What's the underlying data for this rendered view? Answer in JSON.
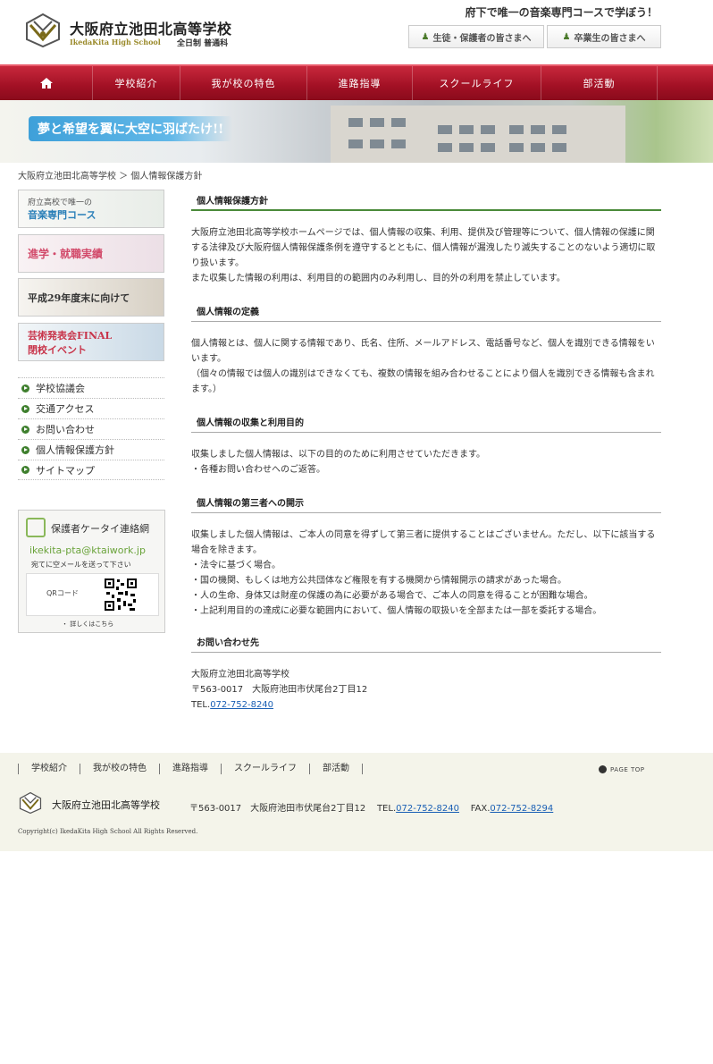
{
  "header": {
    "school_name": "大阪府立池田北高等学校",
    "school_name_en": "IkedaKita High School",
    "course": "全日制 普通科",
    "catch": "府下で唯一の音楽専門コースで学ぼう！",
    "btn_students": "生徒・保護者の皆さまへ",
    "btn_alumni": "卒業生の皆さまへ",
    "logo_icon": "school-emblem-icon",
    "person_icon": "person-icon"
  },
  "nav": {
    "home_icon": "home-icon",
    "items": [
      "学校紹介",
      "我が校の特色",
      "進路指導",
      "スクールライフ",
      "部活動"
    ]
  },
  "banner": {
    "catch": "夢と希望を翼に大空に羽ばたけ!!"
  },
  "breadcrumb": {
    "home": "大阪府立池田北高等学校",
    "sep": "＞",
    "current": "個人情報保護方針"
  },
  "sidebar": {
    "banner1_small": "府立高校で唯一の",
    "banner1_large": "音楽専門コース",
    "banner2": "進学・就職実績",
    "banner3": "平成29年度末に向けて",
    "banner4_line1": "芸術発表会FINAL",
    "banner4_line2": "閉校イベント",
    "links": [
      "学校協議会",
      "交通アクセス",
      "お問い合わせ",
      "個人情報保護方針",
      "サイトマップ"
    ],
    "pta": {
      "title": "保護者ケータイ連絡網",
      "email": "ikekita-pta@ktaiwork.jp",
      "note": "宛てに空メールを送って下さい",
      "qr_label": "QRコード",
      "more": "・ 詳しくはこちら"
    }
  },
  "main": {
    "title": "個人情報保護方針",
    "intro": [
      "大阪府立池田北高等学校ホームページでは、個人情報の収集、利用、提供及び管理等について、個人情報の保護に関する法律及び大阪府個人情報保護条例を遵守するとともに、個人情報が漏洩したり滅失することのないよう適切に取り扱います。",
      "また収集した情報の利用は、利用目的の範囲内のみ利用し、目的外の利用を禁止しています。"
    ],
    "sections": [
      {
        "heading": "個人情報の定義",
        "paragraphs": [
          "個人情報とは、個人に関する情報であり、氏名、住所、メールアドレス、電話番号など、個人を識別できる情報をいいます。",
          "（個々の情報では個人の識別はできなくても、複数の情報を組み合わせることにより個人を識別できる情報も含まれます。）"
        ]
      },
      {
        "heading": "個人情報の収集と利用目的",
        "paragraphs": [
          "収集しました個人情報は、以下の目的のために利用させていただきます。",
          "・各種お問い合わせへのご返答。"
        ]
      },
      {
        "heading": "個人情報の第三者への開示",
        "paragraphs": [
          "収集しました個人情報は、ご本人の同意を得ずして第三者に提供することはございません。ただし、以下に該当する場合を除きます。",
          "・法令に基づく場合。",
          "・国の機関、もしくは地方公共団体など権限を有する機関から情報開示の請求があった場合。",
          "・人の生命、身体又は財産の保護の為に必要がある場合で、ご本人の同意を得ることが困難な場合。",
          "・上記利用目的の達成に必要な範囲内において、個人情報の取扱いを全部または一部を委託する場合。"
        ]
      }
    ],
    "contact_heading": "お問い合わせ先",
    "contact_name": "大阪府立池田北高等学校",
    "contact_address": "〒563-0017　大阪府池田市伏尾台2丁目12",
    "contact_tel_label": "TEL.",
    "contact_tel": "072-752-8240"
  },
  "footer": {
    "nav": [
      "学校紹介",
      "我が校の特色",
      "進路指導",
      "スクールライフ",
      "部活動"
    ],
    "pagetop": "PAGE TOP",
    "school_name": "大阪府立池田北高等学校",
    "address": "〒563-0017　大阪府池田市伏尾台2丁目12",
    "tel_label": "TEL.",
    "tel": "072-752-8240",
    "fax_label": "FAX.",
    "fax": "072-752-8294",
    "copyright": "Copyright(c) IkedaKita High School All Rights Reserved."
  }
}
